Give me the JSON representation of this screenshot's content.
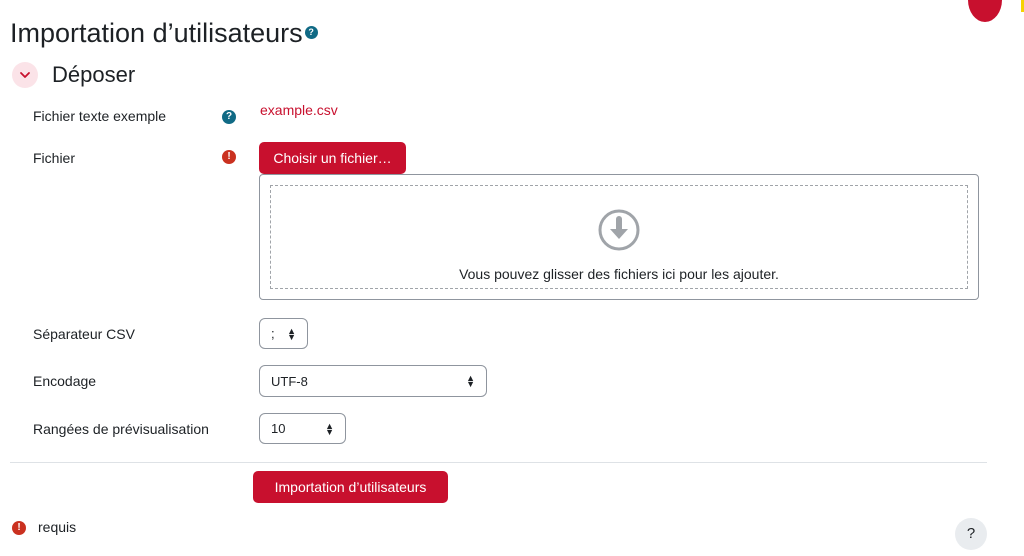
{
  "page": {
    "title": "Importation d’utilisateurs",
    "title_help_icon": "question-icon"
  },
  "section": {
    "title": "Déposer",
    "toggle_icon": "chevron-down-icon"
  },
  "fields": {
    "example": {
      "label": "Fichier texte exemple",
      "link": "example.csv",
      "icon": "question-icon"
    },
    "file": {
      "label": "Fichier",
      "icon": "exclamation-icon",
      "button_label": "Choisir un fichier…",
      "drop_text": "Vous pouvez glisser des fichiers ici pour les ajouter.",
      "drop_icon": "arrow-down-circle-icon"
    },
    "separator": {
      "label": "Séparateur CSV",
      "value": ";"
    },
    "encoding": {
      "label": "Encodage",
      "value": "UTF-8"
    },
    "preview_rows": {
      "label": "Rangées de prévisualisation",
      "value": "10"
    }
  },
  "actions": {
    "submit_label": "Importation d’utilisateurs"
  },
  "footer": {
    "required_label": "requis",
    "help_label": "?"
  },
  "colors": {
    "brand": "#c8102e",
    "help_icon": "#106a85",
    "required_icon": "#ca3120",
    "toggle_bg": "#fbe3e8"
  }
}
